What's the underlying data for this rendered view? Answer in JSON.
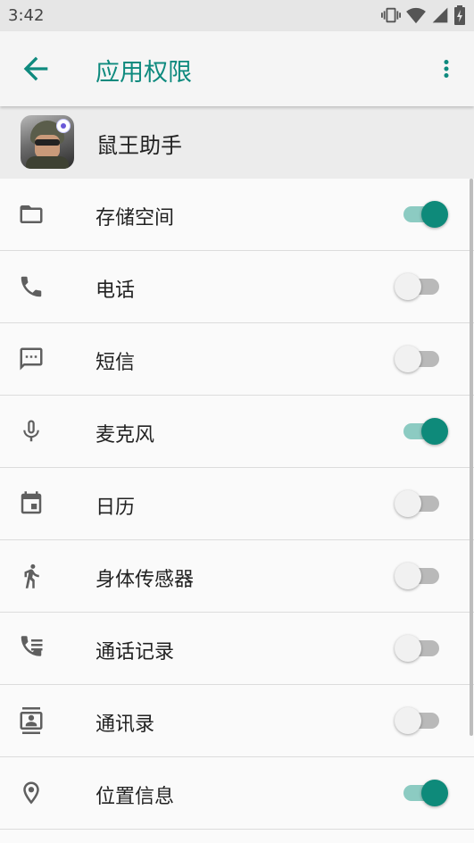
{
  "status_bar": {
    "time": "3:42",
    "icons": [
      "vibrate-icon",
      "wifi-icon",
      "signal-icon",
      "battery-charging-icon"
    ]
  },
  "app_bar": {
    "title": "应用权限",
    "back_icon": "arrow-back-icon",
    "more_icon": "more-vert-icon"
  },
  "app": {
    "name": "鼠王助手"
  },
  "permissions": [
    {
      "label": "存储空间",
      "icon": "folder-icon",
      "enabled": true
    },
    {
      "label": "电话",
      "icon": "phone-icon",
      "enabled": false
    },
    {
      "label": "短信",
      "icon": "sms-icon",
      "enabled": false
    },
    {
      "label": "麦克风",
      "icon": "mic-icon",
      "enabled": true
    },
    {
      "label": "日历",
      "icon": "calendar-icon",
      "enabled": false
    },
    {
      "label": "身体传感器",
      "icon": "walk-icon",
      "enabled": false
    },
    {
      "label": "通话记录",
      "icon": "call-log-icon",
      "enabled": false
    },
    {
      "label": "通讯录",
      "icon": "contacts-icon",
      "enabled": false
    },
    {
      "label": "位置信息",
      "icon": "location-icon",
      "enabled": true
    }
  ],
  "colors": {
    "accent": "#0e8a7e",
    "toggle_on_thumb": "#0e8a7a",
    "toggle_on_track": "#8ccbc2",
    "toggle_off_track": "#b9b9b9",
    "icon": "#5f5f5f"
  }
}
